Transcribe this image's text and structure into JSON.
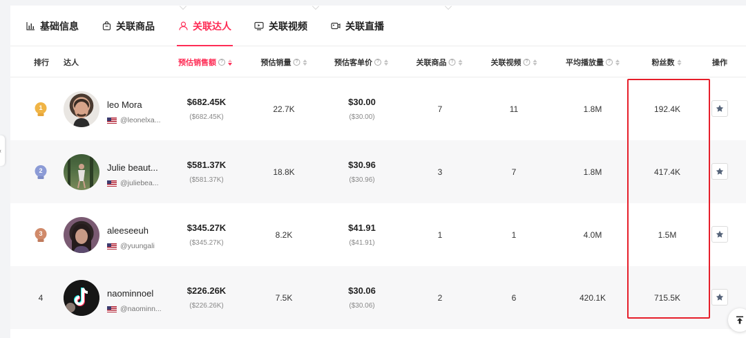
{
  "tabs": [
    {
      "label": "基础信息",
      "icon": "bar-chart-icon"
    },
    {
      "label": "关联商品",
      "icon": "shopping-bag-icon"
    },
    {
      "label": "关联达人",
      "icon": "user-icon",
      "active": true
    },
    {
      "label": "关联视频",
      "icon": "video-icon"
    },
    {
      "label": "关联直播",
      "icon": "live-camera-icon"
    }
  ],
  "columns": {
    "rank": "排行",
    "creator": "达人",
    "est_sales_amount": "预估销售额",
    "est_units": "预估销量",
    "est_avg_price": "预估客单价",
    "linked_products": "关联商品",
    "linked_videos": "关联视频",
    "avg_views": "平均播放量",
    "followers": "粉丝数",
    "actions": "操作"
  },
  "hint_glyph": "?",
  "rows": [
    {
      "rank": "1",
      "name": "leo Mora",
      "handle": "@leonelxa...",
      "sales": "$682.45K",
      "sales_sub": "($682.45K)",
      "units": "22.7K",
      "price": "$30.00",
      "price_sub": "($30.00)",
      "products": "7",
      "videos": "11",
      "avg_views": "1.8M",
      "followers": "192.4K"
    },
    {
      "rank": "2",
      "name": "Julie beaut...",
      "handle": "@juliebea...",
      "sales": "$581.37K",
      "sales_sub": "($581.37K)",
      "units": "18.8K",
      "price": "$30.96",
      "price_sub": "($30.96)",
      "products": "3",
      "videos": "7",
      "avg_views": "1.8M",
      "followers": "417.4K"
    },
    {
      "rank": "3",
      "name": "aleeseeuh",
      "handle": "@yuungali",
      "sales": "$345.27K",
      "sales_sub": "($345.27K)",
      "units": "8.2K",
      "price": "$41.91",
      "price_sub": "($41.91)",
      "products": "1",
      "videos": "1",
      "avg_views": "4.0M",
      "followers": "1.5M"
    },
    {
      "rank": "4",
      "name": "naominnoel",
      "handle": "@naominn...",
      "sales": "$226.26K",
      "sales_sub": "($226.26K)",
      "units": "7.5K",
      "price": "$30.06",
      "price_sub": "($30.06)",
      "products": "2",
      "videos": "6",
      "avg_views": "420.1K",
      "followers": "715.5K"
    }
  ],
  "colors": {
    "accent": "#fe2c55",
    "highlight_box": "#e61e2a",
    "gold": "#f0b445",
    "silver": "#8c9bd6",
    "bronze": "#d08a6a"
  }
}
